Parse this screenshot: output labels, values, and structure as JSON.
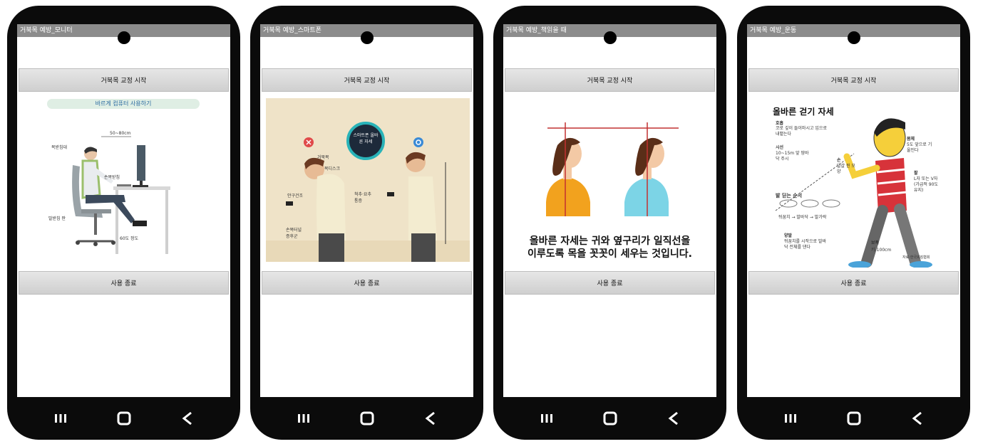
{
  "phones": [
    {
      "title": "거북목 예방_모니터",
      "start_button": "거북목 교정 시작",
      "end_button": "사용 종료",
      "illustration": {
        "banner": "바르게 컴퓨터 사용하기",
        "labels": [
          "목받침대",
          "50~80cm",
          "손목받침",
          "발받침 판",
          "60도 정도"
        ]
      }
    },
    {
      "title": "거북목 예방_스마트폰",
      "start_button": "거북목 교정 시작",
      "end_button": "사용 종료",
      "illustration": {
        "badge": "스마트폰 올바른 자세",
        "labels": [
          "거북목",
          "목디스크",
          "안구건조",
          "척추·요추통증",
          "손목터널 증후군"
        ]
      }
    },
    {
      "title": "거북목 예방_책읽을 때",
      "start_button": "거북목 교정 시작",
      "end_button": "사용 종료",
      "illustration": {
        "caption_line1": "올바른 자세는 귀와 옆구리가 일직선을",
        "caption_line2": "이루도록 목을 꼿꼿이 세우는 것입니다."
      }
    },
    {
      "title": "거북목 예방_운동",
      "start_button": "거북목 교정 시작",
      "end_button": "사용 종료",
      "illustration": {
        "heading": "올바른 걷기 자세",
        "breath_title": "호흡",
        "breath_text": "코로 깊이 들이마시고 입으로 내뱉는다",
        "gaze_title": "시선",
        "gaze_text": "10~15m 앞 땅바닥 주시",
        "hand_title": "손",
        "hand_text": "달걀 쥔 모양",
        "body_title": "몸체",
        "body_text": "5도 앞으로 기울인다",
        "arm_title": "팔",
        "arm_text": "L자 또는 V자 (가급적 90도 유지)",
        "steps_title": "발 딛는 순서",
        "steps_text": "뒤꿈치 → 발바닥 → 발가락",
        "feet_title": "양발",
        "feet_text": "뒤꿈치를 시작으로 발바닥 전체를 댄다",
        "stride_title": "보폭",
        "stride_text": "키-100cm",
        "source": "자료:한국워킹협회"
      }
    }
  ],
  "nav_icons": [
    "recent-apps-icon",
    "home-icon",
    "back-icon"
  ]
}
